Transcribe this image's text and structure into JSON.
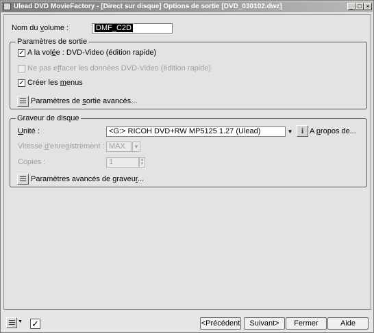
{
  "window": {
    "title": "Ulead DVD MovieFactory - [Direct sur disque] Options de sortie   [DVD_030102.dwz]",
    "minimize": "_",
    "maximize": "□",
    "close": "×"
  },
  "volume": {
    "label_pre": "Nom du ",
    "label_u": "v",
    "label_post": "olume :",
    "value": "DMF_C2D"
  },
  "output_group": {
    "legend": "Paramètres de sortie",
    "fly_pre": "A la vol",
    "fly_u": "é",
    "fly_post": "e : DVD-Video (édition rapide)",
    "fly_checked": true,
    "noerase_pre": "Ne pas e",
    "noerase_u": "f",
    "noerase_post": "facer les données DVD-Video (édition rapide)",
    "menus_pre": "Créer les ",
    "menus_u": "m",
    "menus_post": "enus",
    "menus_checked": true,
    "advanced_pre": "Paramètres de ",
    "advanced_u": "s",
    "advanced_post": "ortie avancés..."
  },
  "burner_group": {
    "legend": "Graveur de disque",
    "unit_pre": "",
    "unit_u": "U",
    "unit_post": "nité :",
    "unit_value": "<G:>  RICOH DVD+RW MP5125  1.27 (Ulead)",
    "about_pre": "A ",
    "about_u": "p",
    "about_post": "ropos de...",
    "speed_pre": "Vitesse ",
    "speed_u": "d",
    "speed_post": "'enregistrement :",
    "speed_value": "MAX",
    "copies_label": "Copies :",
    "copies_value": "1",
    "advanced_pre": "Paramètres avancés de graveu",
    "advanced_u": "r",
    "advanced_post": "..."
  },
  "footer": {
    "prev": "<Précédent",
    "next": "Suivant>",
    "close": "Fermer",
    "help": "Aide",
    "check": "✓"
  },
  "icons": [
    "app-icon",
    "menu-list-icon",
    "checkmark-icon",
    "settings-list-icon",
    "info-icon",
    "dropdown-arrow-icon",
    "spin-arrows-icon"
  ]
}
